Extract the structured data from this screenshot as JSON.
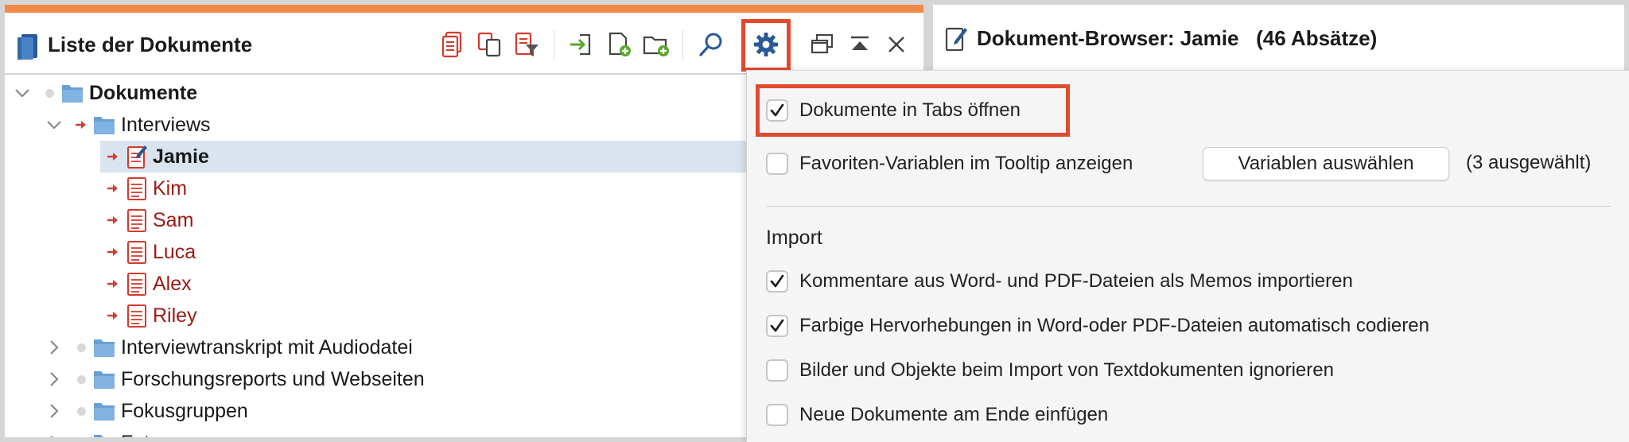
{
  "colors": {
    "accent": "#f08a48",
    "highlight": "#e04a2f",
    "selection": "#dae4ef",
    "folder": "#6a9fd4",
    "document_red": "#d23b2e",
    "document_text_red": "#9c1a14"
  },
  "left_panel": {
    "title": "Liste der Dokumente",
    "toolbar": [
      {
        "name": "activate-all-documents-icon"
      },
      {
        "name": "copy-documents-icon"
      },
      {
        "name": "filter-documents-icon"
      },
      {
        "name": "import-documents-icon"
      },
      {
        "name": "new-document-icon"
      },
      {
        "name": "new-document-group-icon"
      },
      {
        "name": "search-icon"
      },
      {
        "name": "gear-icon",
        "selected": true
      },
      {
        "name": "undock-window-icon"
      },
      {
        "name": "collapse-window-icon"
      },
      {
        "name": "close-icon"
      }
    ],
    "tree": {
      "root": "Dokumente",
      "interviews_folder": "Interviews",
      "documents": [
        "Jamie",
        "Kim",
        "Sam",
        "Luca",
        "Alex",
        "Riley"
      ],
      "selected_document": "Jamie",
      "other_folders": [
        "Interviewtranskript mit Audiodatei",
        "Forschungsreports und Webseiten",
        "Fokusgruppen",
        "Fotos"
      ]
    }
  },
  "right_panel": {
    "title": "Dokument-Browser: Jamie",
    "paragraph_count": "(46 Absätze)"
  },
  "settings_popover": {
    "open_in_tabs": {
      "label": "Dokumente in Tabs öffnen",
      "checked": true
    },
    "favorite_variables": {
      "label": "Favoriten-Variablen im Tooltip anzeigen",
      "checked": false
    },
    "select_variables_button": "Variablen auswählen",
    "selected_count": "(3 ausgewählt)",
    "import_heading": "Import",
    "import_options": [
      {
        "label": "Kommentare aus Word- und PDF-Dateien als Memos importieren",
        "checked": true
      },
      {
        "label": "Farbige Hervorhebungen in Word-oder PDF-Dateien automatisch codieren",
        "checked": true
      },
      {
        "label": "Bilder und Objekte beim Import von Textdokumenten ignorieren",
        "checked": false
      },
      {
        "label": "Neue Dokumente am Ende einfügen",
        "checked": false
      }
    ]
  }
}
